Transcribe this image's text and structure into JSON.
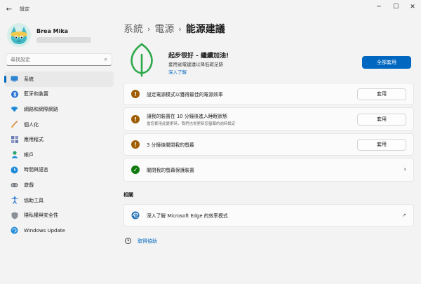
{
  "window": {
    "title": "設定",
    "controls": {
      "minimize": "─",
      "maximize": "☐",
      "close": "✕"
    }
  },
  "profile": {
    "name": "Brea Mika"
  },
  "search": {
    "placeholder": "尋找設定"
  },
  "nav": [
    {
      "label": "系統",
      "icon": "monitor-icon",
      "active": true
    },
    {
      "label": "藍牙和裝置",
      "icon": "bluetooth-icon"
    },
    {
      "label": "網路和網際網路",
      "icon": "wifi-icon"
    },
    {
      "label": "個人化",
      "icon": "paintbrush-icon"
    },
    {
      "label": "應用程式",
      "icon": "apps-icon"
    },
    {
      "label": "帳戶",
      "icon": "person-icon"
    },
    {
      "label": "時間與語言",
      "icon": "globe-clock-icon"
    },
    {
      "label": "遊戲",
      "icon": "gamepad-icon"
    },
    {
      "label": "協助工具",
      "icon": "accessibility-icon"
    },
    {
      "label": "隱私權與安全性",
      "icon": "shield-icon"
    },
    {
      "label": "Windows Update",
      "icon": "update-icon"
    }
  ],
  "breadcrumb": {
    "part1": "系統",
    "part2": "電源",
    "current": "能源建議",
    "sep": "›"
  },
  "hero": {
    "title": "起步很好 - 繼續加油!",
    "desc": "套用省電建議以降低碳足跡",
    "link": "深入了解",
    "apply_all": "全部套用"
  },
  "recommendations": [
    {
      "title": "設定電源模式以獲得最佳的電源效率",
      "sub": "",
      "status": "warning",
      "action": "套用"
    },
    {
      "title": "讓我的裝置在 10 分鐘後進入睡眠狀態",
      "sub": "當您套用此變更時，我們也會更新您螢幕的逾時設定",
      "status": "warning",
      "action": "套用"
    },
    {
      "title": "3 分鐘後關閉我的螢幕",
      "sub": "",
      "status": "warning",
      "action": "套用"
    },
    {
      "title": "關閉我的螢幕保護裝置",
      "sub": "",
      "status": "done",
      "action": ""
    }
  ],
  "status_glyphs": {
    "warning": "!",
    "done": "✓",
    "chevron": "›"
  },
  "related": {
    "heading": "相關",
    "item": "深入了解 Microsoft Edge 的效率模式",
    "external_glyph": "↗"
  },
  "help": {
    "label": "取得協助"
  },
  "colors": {
    "accent": "#0067c0",
    "warning": "#9d5d00",
    "success": "#0f7b0f",
    "leaf": "#2da84a"
  }
}
